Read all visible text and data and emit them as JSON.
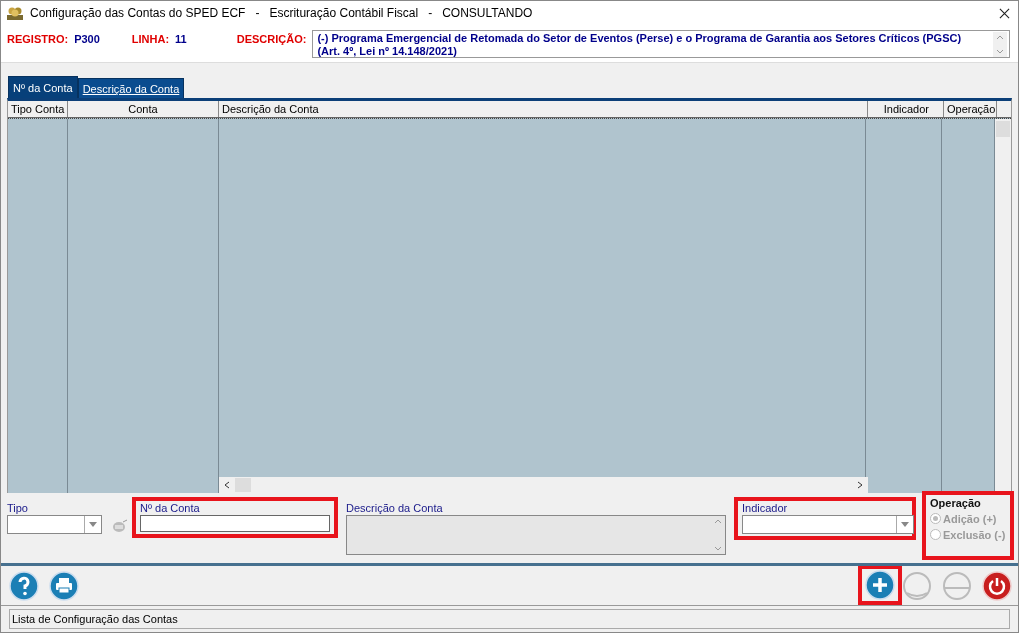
{
  "window": {
    "title": "Configuração das Contas do SPED ECF   -   Escrituração Contábil Fiscal   -   CONSULTANDO"
  },
  "header": {
    "registro_label": "REGISTRO:",
    "registro": "P300",
    "linha_label": "LINHA:",
    "linha": "11",
    "descricao_label": "DESCRIÇÃO:",
    "descricao": "(-) Programa Emergencial de Retomada do Setor de Eventos (Perse) e o Programa de Garantia aos Setores Críticos (PGSC) (Art. 4º, Lei nº 14.148/2021)"
  },
  "tabs": [
    {
      "label": "Nº da Conta",
      "selected": true
    },
    {
      "label": "Descrição da Conta",
      "selected": false
    }
  ],
  "table": {
    "columns": [
      "Tipo Conta",
      "Conta",
      "Descrição da Conta",
      "Indicador",
      "Operação"
    ]
  },
  "form": {
    "tipo": {
      "label": "Tipo",
      "highlighted": false
    },
    "conta": {
      "label": "Nº da Conta",
      "highlighted": true
    },
    "descricao": {
      "label": "Descrição da Conta",
      "highlighted": false
    },
    "indicador": {
      "label": "Indicador",
      "highlighted": true
    },
    "operacao": {
      "label": "Operação",
      "highlighted": true,
      "options": [
        {
          "label": "Adição (+)",
          "selected": true
        },
        {
          "label": "Exclusão (-)",
          "selected": false
        }
      ]
    }
  },
  "toolbar": {
    "add_highlighted": true
  },
  "status_bar": "Lista de Configuração das Contas"
}
